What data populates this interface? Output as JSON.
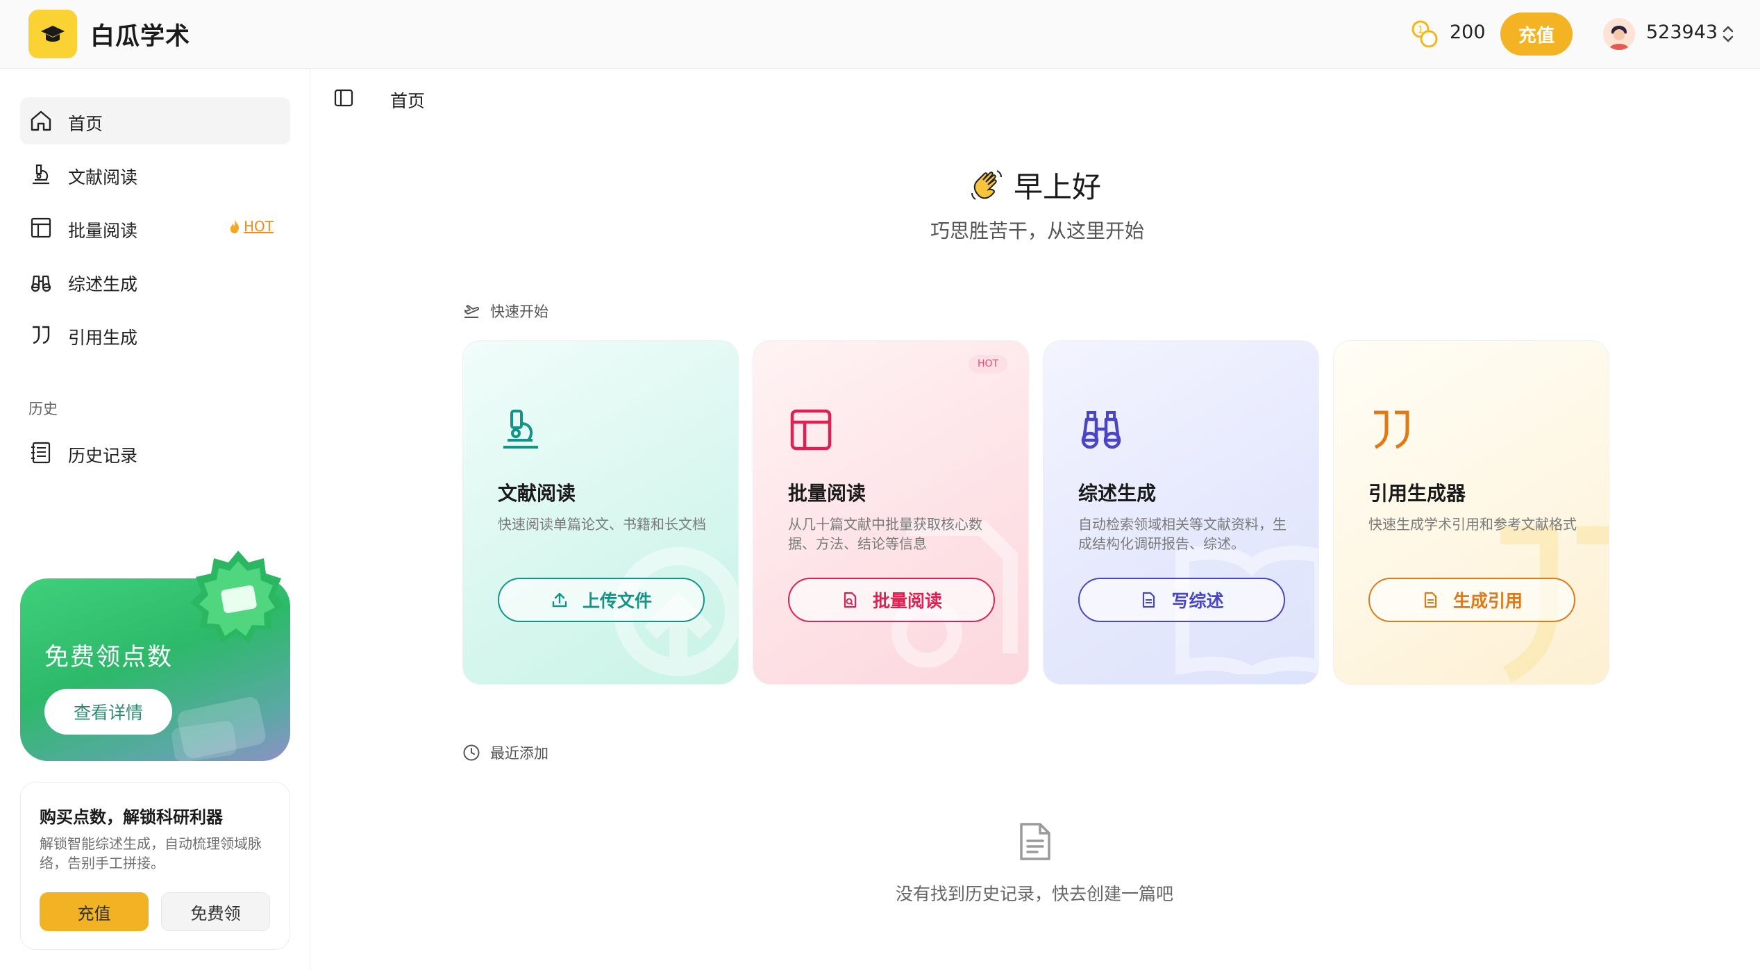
{
  "app": {
    "title": "白瓜学术"
  },
  "header": {
    "coins": "200",
    "recharge_label": "充值",
    "username": "523943"
  },
  "sidebar": {
    "items": [
      {
        "label": "首页",
        "icon": "home-icon",
        "active": true
      },
      {
        "label": "文献阅读",
        "icon": "microscope-icon"
      },
      {
        "label": "批量阅读",
        "icon": "table-icon",
        "badge": "HOT"
      },
      {
        "label": "综述生成",
        "icon": "binoculars-icon"
      },
      {
        "label": "引用生成",
        "icon": "quote-icon"
      }
    ],
    "history_section": "历史",
    "history_item": "历史记录",
    "promo": {
      "title": "免费领点数",
      "button": "查看详情"
    },
    "buy": {
      "title": "购买点数，解锁科研利器",
      "desc": "解锁智能综述生成，自动梳理领域脉络，告别手工拼接。",
      "recharge": "充值",
      "free": "免费领"
    }
  },
  "main": {
    "breadcrumb": "首页",
    "greeting": "早上好",
    "subgreeting": "巧思胜苦干，从这里开始",
    "quick_start": "快速开始",
    "cards": [
      {
        "title": "文献阅读",
        "desc": "快速阅读单篇论文、书籍和长文档",
        "button": "上传文件",
        "color": "#129488"
      },
      {
        "title": "批量阅读",
        "desc": "从几十篇文献中批量获取核心数据、方法、结论等信息",
        "button": "批量阅读",
        "badge": "HOT",
        "color": "#e02053"
      },
      {
        "title": "综述生成",
        "desc": "自动检索领域相关等文献资料，生成结构化调研报告、综述。",
        "button": "写综述",
        "color": "#4a44c6"
      },
      {
        "title": "引用生成器",
        "desc": "快速生成学术引用和参考文献格式",
        "button": "生成引用",
        "color": "#e07a17"
      }
    ],
    "recent": "最近添加",
    "empty": "没有找到历史记录，快去创建一篇吧"
  }
}
